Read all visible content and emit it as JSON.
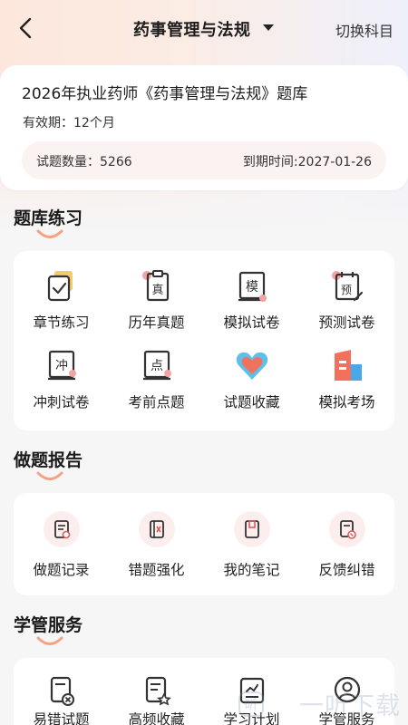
{
  "nav": {
    "title": "药事管理与法规",
    "switch_label": "切换科目"
  },
  "bank": {
    "title": "2026年执业药师《药事管理与法规》题库",
    "valid": "有效期：12个月",
    "count_label": "试题数量：5266",
    "expire_label": "到期时间:2027-01-26"
  },
  "sections": {
    "practice": {
      "title": "题库练习",
      "items": [
        {
          "label": "章节练习",
          "icon": "checklist-icon"
        },
        {
          "label": "历年真题",
          "icon": "true-exam-icon"
        },
        {
          "label": "模拟试卷",
          "icon": "mock-paper-icon"
        },
        {
          "label": "预测试卷",
          "icon": "forecast-paper-icon"
        },
        {
          "label": "冲刺试卷",
          "icon": "sprint-paper-icon"
        },
        {
          "label": "考前点题",
          "icon": "key-points-icon"
        },
        {
          "label": "试题收藏",
          "icon": "heart-icon"
        },
        {
          "label": "模拟考场",
          "icon": "exam-room-icon"
        }
      ]
    },
    "report": {
      "title": "做题报告",
      "items": [
        {
          "label": "做题记录",
          "icon": "record-icon"
        },
        {
          "label": "错题强化",
          "icon": "wrong-questions-icon"
        },
        {
          "label": "我的笔记",
          "icon": "notes-icon"
        },
        {
          "label": "反馈纠错",
          "icon": "feedback-icon"
        }
      ]
    },
    "service": {
      "title": "学管服务",
      "items": [
        {
          "label": "易错试题",
          "icon": "error-prone-icon"
        },
        {
          "label": "高频收藏",
          "icon": "frequent-favorites-icon"
        },
        {
          "label": "学习计划",
          "icon": "study-plan-icon"
        },
        {
          "label": "学管服务",
          "icon": "user-service-icon"
        }
      ]
    }
  },
  "watermark": "一听下载",
  "colors": {
    "accent": "#f07a5a",
    "icon_dark": "#333333",
    "icon_red": "#e05a5a",
    "icon_blue": "#3aa0e0",
    "icon_orange": "#f7b24a"
  }
}
